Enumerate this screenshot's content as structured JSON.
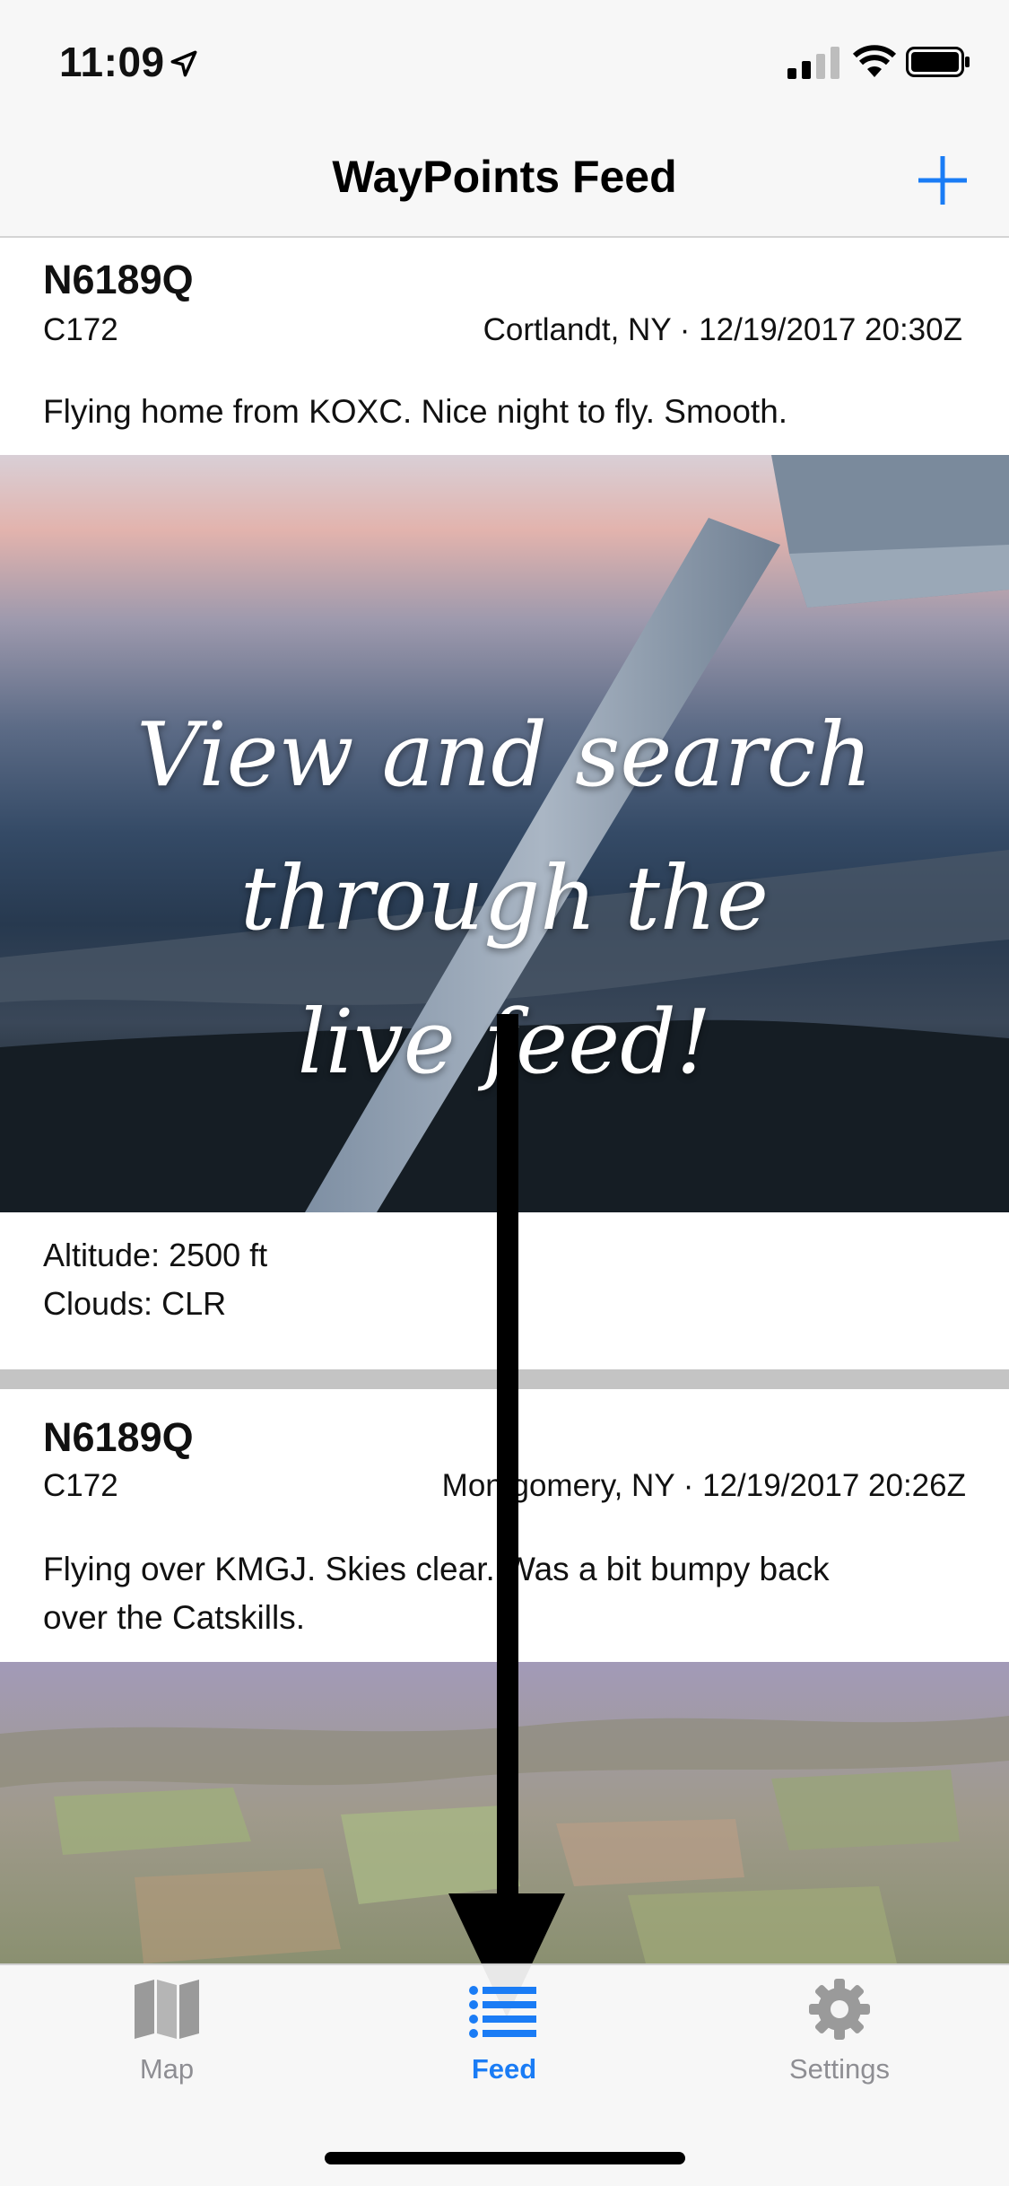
{
  "status_bar": {
    "time": "11:09"
  },
  "nav": {
    "title": "WayPoints Feed",
    "add_icon": "plus-icon",
    "accent": "#1a7cf5"
  },
  "posts": [
    {
      "tail": "N6189Q",
      "aircraft": "C172",
      "location_time": "Cortlandt, NY · 12/19/2017 20:30Z",
      "caption": "Flying home from KOXC. Nice night to fly. Smooth.",
      "altitude": "Altitude: 2500 ft",
      "clouds": "Clouds: CLR"
    },
    {
      "tail": "N6189Q",
      "aircraft": "C172",
      "location_time": "Montgomery, NY · 12/19/2017 20:26Z",
      "caption_line1": "Flying over KMGJ. Skies clear. Was a bit bumpy back",
      "caption_line2": "over the Catskills."
    }
  ],
  "overlay": {
    "line1": "View and search through the",
    "line2": "live feed!"
  },
  "tabs": [
    {
      "label": "Map",
      "icon": "map-icon",
      "selected": false
    },
    {
      "label": "Feed",
      "icon": "list-icon",
      "selected": true
    },
    {
      "label": "Settings",
      "icon": "gear-icon",
      "selected": false
    }
  ],
  "colors": {
    "tab_selected": "#1a7cf5",
    "tab_unselected": "#8e8e93"
  }
}
